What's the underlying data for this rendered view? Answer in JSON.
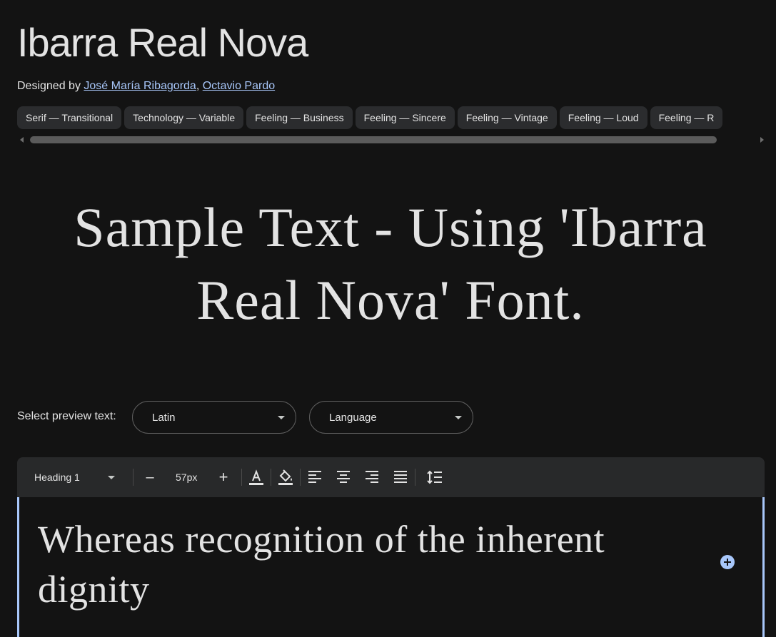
{
  "font": {
    "name": "Ibarra Real Nova",
    "designed_by_label": "Designed by",
    "designers": [
      "José María Ribagorda",
      "Octavio Pardo"
    ],
    "separator": ","
  },
  "tags": [
    "Serif — Transitional",
    "Technology — Variable",
    "Feeling — Business",
    "Feeling — Sincere",
    "Feeling — Vintage",
    "Feeling — Loud",
    "Feeling — R"
  ],
  "sample_text": [
    "Sample Text - Using 'Ibarra",
    "Real Nova' Font."
  ],
  "preview": {
    "label": "Select preview text:",
    "script_select": "Latin",
    "language_select": "Language"
  },
  "toolbar": {
    "heading_select": "Heading 1",
    "minus": "–",
    "font_size": "57px",
    "plus": "+"
  },
  "editor": {
    "text": "Whereas recognition of the inherent dignity"
  },
  "colors": {
    "background": "#131313",
    "link": "#a8c7fa",
    "chip": "#2b2c2e",
    "toolbar": "#28292a",
    "accent": "#a8c7fa"
  }
}
